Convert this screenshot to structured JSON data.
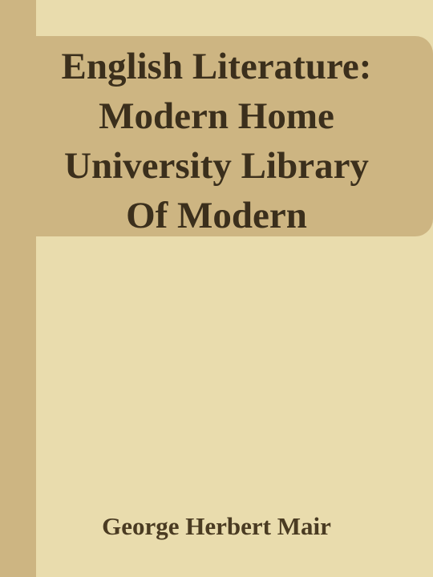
{
  "book": {
    "title_lines": [
      "English Literature:",
      "Modern Home",
      "University Library",
      "Of Modern"
    ],
    "author": "George Herbert Mair"
  },
  "colors": {
    "background": "#e9dcad",
    "band": "#cdb582",
    "text": "#3b2f1c"
  }
}
